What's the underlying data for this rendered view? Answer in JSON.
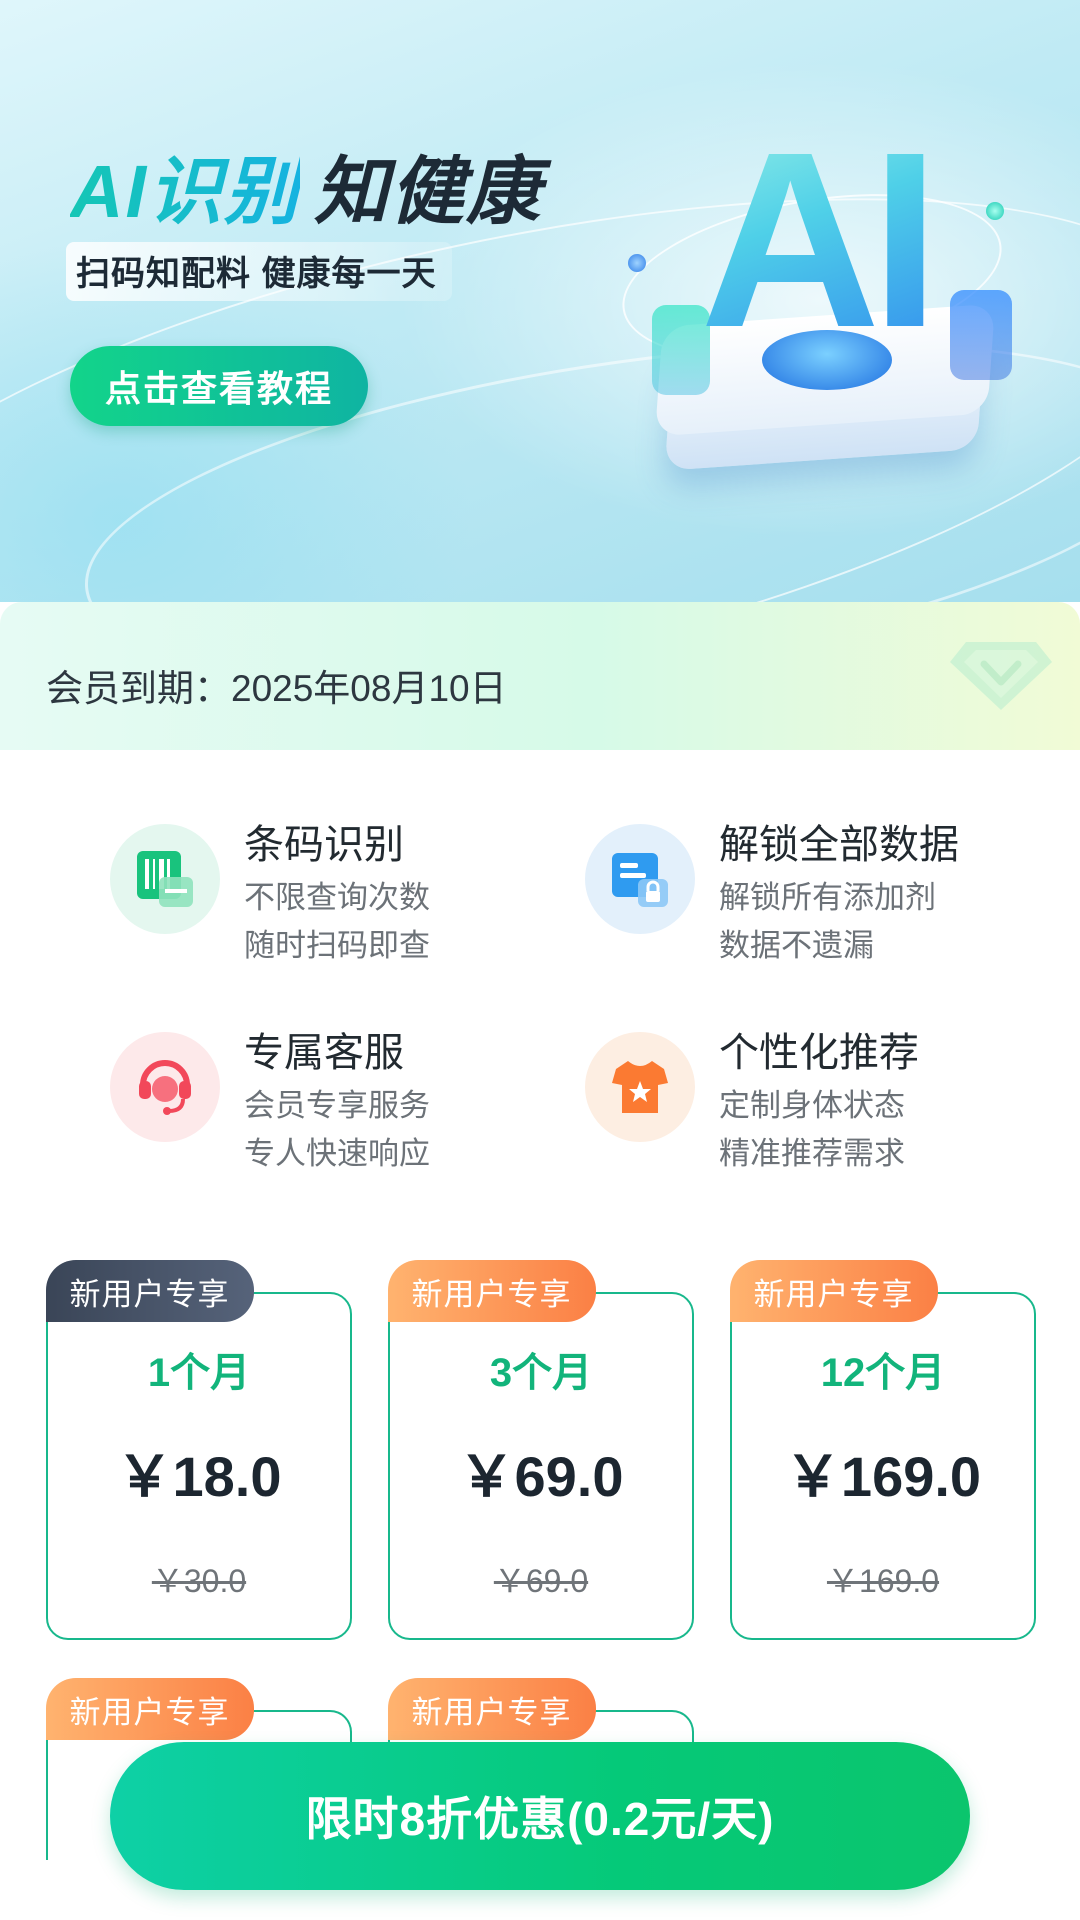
{
  "banner": {
    "headline_accent": "AI识别",
    "headline_rest": "知健康",
    "subline": "扫码知配料 健康每一天",
    "tutorial_button": "点击查看教程",
    "art_text": "AI"
  },
  "membership": {
    "expiry": "会员到期：2025年08月10日"
  },
  "benefits": [
    {
      "icon": "barcode-scan-icon",
      "title": "条码识别",
      "line1": "不限查询次数",
      "line2": "随时扫码即查",
      "color": "#19c37d"
    },
    {
      "icon": "unlock-data-icon",
      "title": "解锁全部数据",
      "line1": "解锁所有添加剂",
      "line2": "数据不遗漏",
      "color": "#2f9bf0"
    },
    {
      "icon": "customer-service-icon",
      "title": "专属客服",
      "line1": "会员专享服务",
      "line2": "专人快速响应",
      "color": "#f2485a"
    },
    {
      "icon": "recommend-shirt-icon",
      "title": "个性化推荐",
      "line1": "定制身体状态",
      "line2": "精准推荐需求",
      "color": "#fb7a32"
    }
  ],
  "plans": [
    {
      "tag": "新用户专享",
      "duration": "1个月",
      "price": "￥18.0",
      "original": "￥30.0",
      "selected": true
    },
    {
      "tag": "新用户专享",
      "duration": "3个月",
      "price": "￥69.0",
      "original": "￥69.0",
      "selected": false
    },
    {
      "tag": "新用户专享",
      "duration": "12个月",
      "price": "￥169.0",
      "original": "￥169.0",
      "selected": false
    },
    {
      "tag": "新用户专享"
    },
    {
      "tag": "新用户专享"
    }
  ],
  "cta": {
    "label": "限时8折优惠(0.2元/天)"
  },
  "colors": {
    "brand_green": "#12b47b",
    "tag_dark": "#3a4557",
    "tag_orange": "#fb8045"
  }
}
